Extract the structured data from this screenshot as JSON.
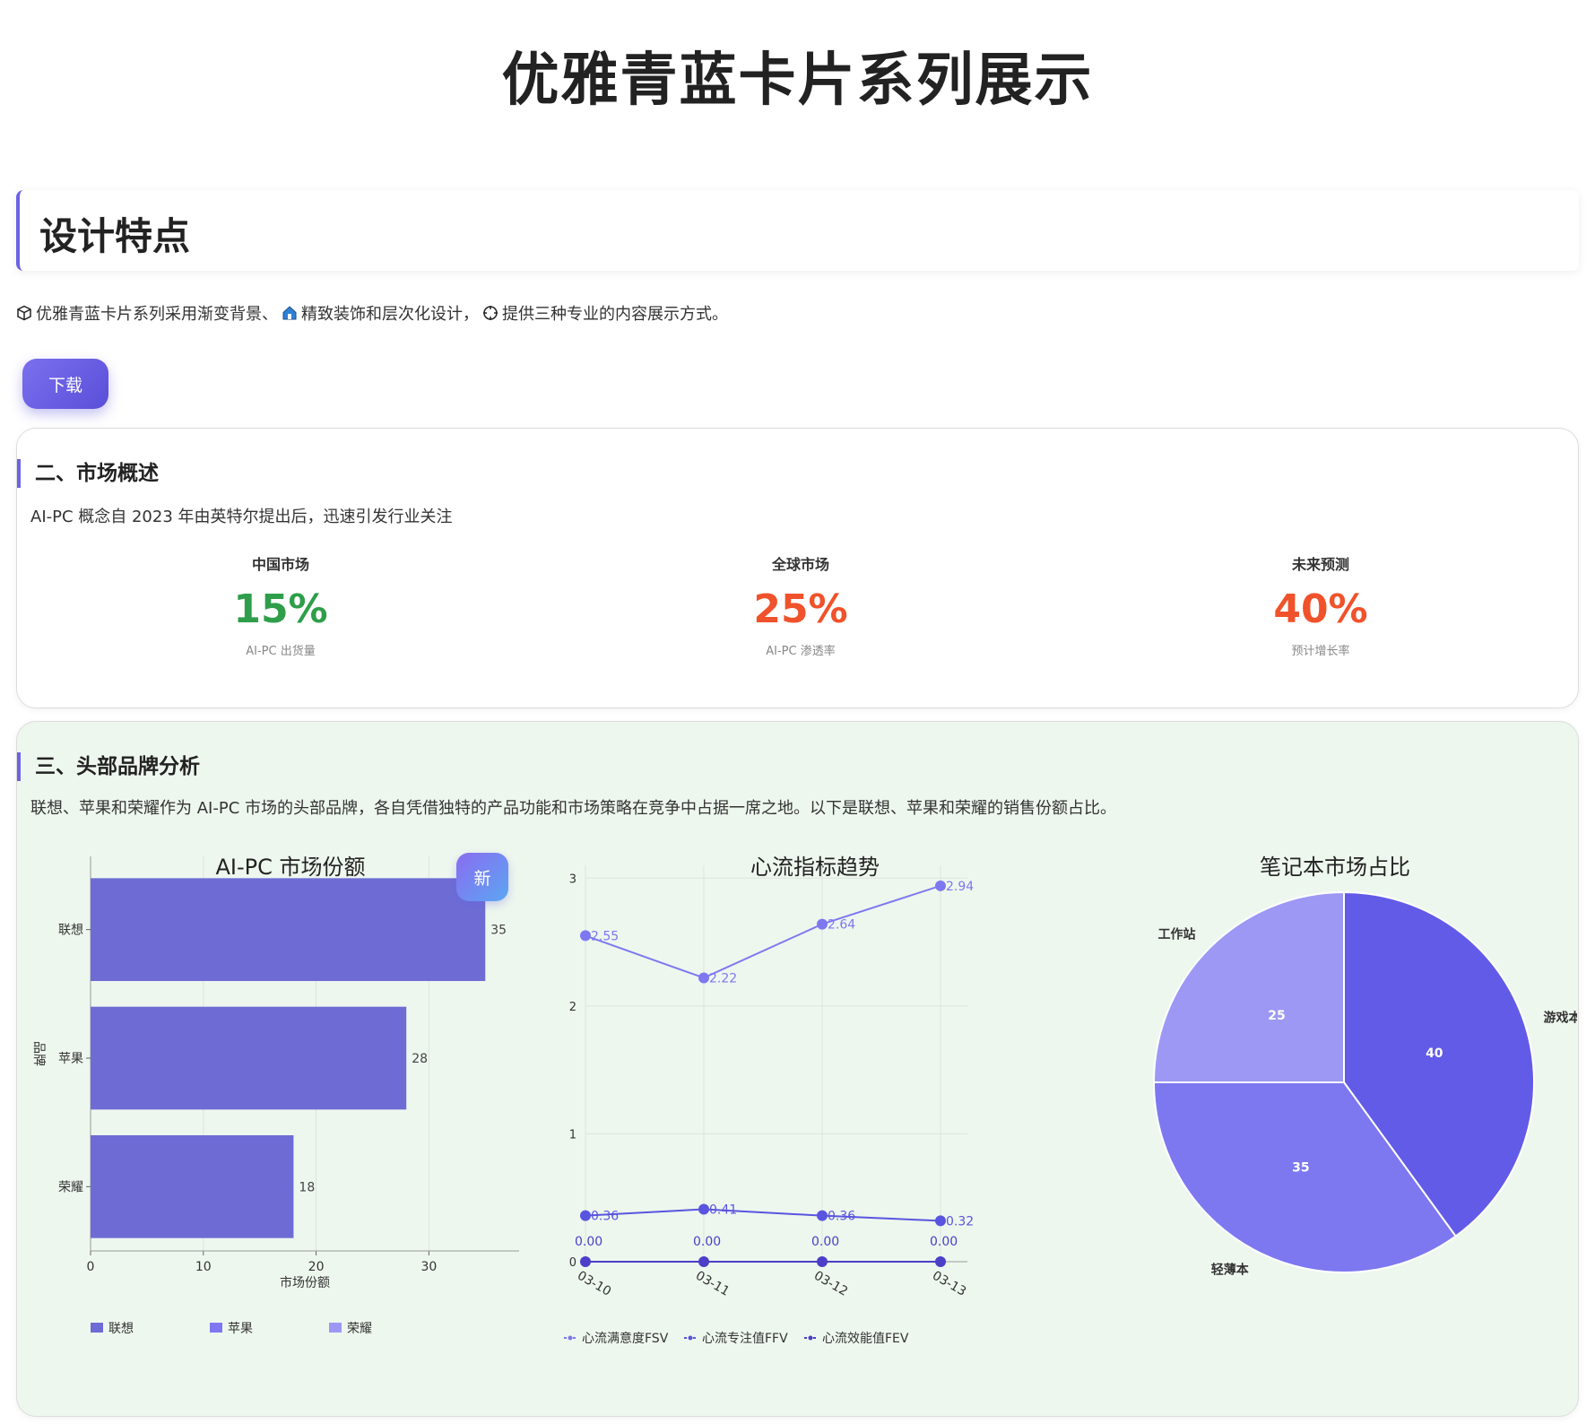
{
  "header": {
    "title": "优雅青蓝卡片系列展示"
  },
  "features": {
    "title": "设计特点",
    "desc_part1": "优雅青蓝卡片系列采用渐变背景、",
    "desc_part2": "精致装饰和层次化设计，",
    "desc_part3": "提供三种专业的内容展示方式。",
    "icons": [
      "cube-icon",
      "house-icon",
      "crosshair-icon"
    ]
  },
  "actions": {
    "download_label": "下载"
  },
  "market": {
    "title": "二、市场概述",
    "desc": "AI-PC 概念自 2023 年由英特尔提出后，迅速引发行业关注",
    "stats": [
      {
        "label": "中国市场",
        "value": "15%",
        "sub": "AI-PC 出货量",
        "color": "#2e9e4a"
      },
      {
        "label": "全球市场",
        "value": "25%",
        "sub": "AI-PC 渗透率",
        "color": "#f0522b"
      },
      {
        "label": "未来预测",
        "value": "40%",
        "sub": "预计增长率",
        "color": "#f0522b"
      }
    ]
  },
  "brand": {
    "title": "三、头部品牌分析",
    "desc": "联想、苹果和荣耀作为 AI-PC 市场的头部品牌，各自凭借独特的产品功能和市场策略在竞争中占据一席之地。以下是联想、苹果和荣耀的销售份额占比。",
    "badge": "新"
  },
  "colors": {
    "accent": "#6b63e3",
    "bar": "#6e6cd4",
    "pie1": "#625be8",
    "pie2": "#7d78f0",
    "pie3": "#9d98f4"
  },
  "chart_data": [
    {
      "type": "bar",
      "orientation": "horizontal",
      "title": "AI-PC 市场份额",
      "categories": [
        "联想",
        "苹果",
        "荣耀"
      ],
      "values": [
        35,
        28,
        18
      ],
      "xlabel": "市场份额",
      "ylabel": "品牌",
      "xlim": [
        0,
        38
      ],
      "xticks": [
        "0",
        "10",
        "20",
        "30"
      ],
      "legend": [
        "联想",
        "苹果",
        "荣耀"
      ],
      "legend_position": "bottom",
      "grid": true
    },
    {
      "type": "line",
      "title": "心流指标趋势",
      "x": [
        "03-10",
        "03-11",
        "03-12",
        "03-13"
      ],
      "series": [
        {
          "name": "心流满意度FSV",
          "values": [
            2.55,
            2.22,
            2.64,
            2.94
          ],
          "labels": [
            "2.55",
            "2.22",
            "2.64",
            "2.94"
          ]
        },
        {
          "name": "心流专注值FFV",
          "values": [
            0.36,
            0.41,
            0.36,
            0.32
          ],
          "labels": [
            "0.36",
            "0.41",
            "0.36",
            "0.32"
          ]
        },
        {
          "name": "心流效能值FEV",
          "values": [
            0,
            0,
            0,
            0
          ],
          "labels": [
            "0.00",
            "0.00",
            "0.00",
            "0.00"
          ]
        }
      ],
      "ylim": [
        0,
        3.1
      ],
      "yticks": [
        "0",
        "1",
        "2",
        "3"
      ],
      "legend_position": "bottom",
      "grid": true
    },
    {
      "type": "pie",
      "title": "笔记本市场占比",
      "slices": [
        {
          "name": "游戏本",
          "value": 40,
          "label": "40"
        },
        {
          "name": "轻薄本",
          "value": 35,
          "label": "35"
        },
        {
          "name": "工作站",
          "value": 25,
          "label": "25"
        }
      ]
    }
  ]
}
